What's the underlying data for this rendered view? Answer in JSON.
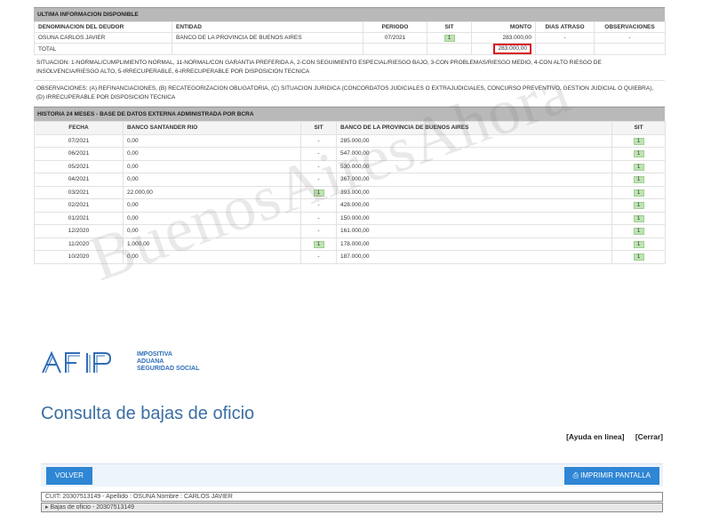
{
  "ultima": {
    "header": "ULTIMA INFORMACION DISPONIBLE",
    "columns": [
      "DENOMINACION DEL DEUDOR",
      "ENTIDAD",
      "PERIODO",
      "SIT",
      "MONTO",
      "DIAS ATRASO",
      "OBSERVACIONES"
    ],
    "row": {
      "deudor": "OSUNA CARLOS JAVIER",
      "entidad": "BANCO DE LA PROVINCIA DE BUENOS AIRES",
      "periodo": "07/2021",
      "sit": "1",
      "monto": "283.000,00",
      "dias": "-",
      "obs": "-"
    },
    "total_label": "TOTAL",
    "total_value": "283.000,00"
  },
  "situacion_note": "SITUACION: 1-NORMAL/CUMPLIMIENTO NORMAL, 11-NORMAL/CON GARANTIA PREFERIDA A, 2-CON SEGUIMIENTO ESPECIAL/RIESGO BAJO, 3-CON PROBLEMAS/RIESGO MEDIO, 4-CON ALTO RIESGO DE INSOLVENCIA/RIESGO ALTO, 5-IRRECUPERABLE, 6-IRRECUPERABLE POR DISPOSICION TECNICA",
  "observaciones_note": "OBSERVACIONES: (A) REFINANCIACIONES, (B) RECATEGORIZACION OBLIGATORIA, (C) SITUACION JURIDICA (CONCORDATOS JUDICIALES O EXTRAJUDICIALES, CONCURSO PREVENTIVO, GESTION JUDICIAL O QUIEBRA), (D) IRRECUPERABLE POR DISPOSICION TECNICA",
  "historia": {
    "header": "HISTORIA 24 MESES - BASE DE DATOS EXTERNA ADMINISTRADA POR BCRA",
    "columns": [
      "FECHA",
      "BANCO SANTANDER RIO",
      "SIT",
      "BANCO DE LA PROVINCIA DE BUENOS AIRES",
      "SIT"
    ],
    "rows": [
      {
        "fecha": "07/2021",
        "santander": "0,00",
        "sit1": "-",
        "provincia": "285.000,00",
        "sit2": "1"
      },
      {
        "fecha": "06/2021",
        "santander": "0,00",
        "sit1": "-",
        "provincia": "547.000,00",
        "sit2": "1"
      },
      {
        "fecha": "05/2021",
        "santander": "0,00",
        "sit1": "-",
        "provincia": "530.000,00",
        "sit2": "1"
      },
      {
        "fecha": "04/2021",
        "santander": "0,00",
        "sit1": "-",
        "provincia": "367.000,00",
        "sit2": "1"
      },
      {
        "fecha": "03/2021",
        "santander": "22.000,00",
        "sit1": "1",
        "provincia": "393.000,00",
        "sit2": "1"
      },
      {
        "fecha": "02/2021",
        "santander": "0,00",
        "sit1": "-",
        "provincia": "428.000,00",
        "sit2": "1"
      },
      {
        "fecha": "01/2021",
        "santander": "0,00",
        "sit1": "-",
        "provincia": "150.000,00",
        "sit2": "1"
      },
      {
        "fecha": "12/2020",
        "santander": "0,00",
        "sit1": "-",
        "provincia": "161.000,00",
        "sit2": "1"
      },
      {
        "fecha": "11/2020",
        "santander": "1.000,00",
        "sit1": "1",
        "provincia": "178.000,00",
        "sit2": "1"
      },
      {
        "fecha": "10/2020",
        "santander": "0,00",
        "sit1": "-",
        "provincia": "187.000,00",
        "sit2": "1"
      }
    ]
  },
  "watermark": "BuenosAiresAhora",
  "afip": {
    "logo_text": "AFIP",
    "logo_lines": [
      "IMPOSITIVA",
      "ADUANA",
      "SEGURIDAD SOCIAL"
    ],
    "page_title": "Consulta de bajas de oficio",
    "link_help": "[Ayuda en linea]",
    "link_close": "[Cerrar]",
    "btn_volver": "VOLVER",
    "btn_print": "IMPRIMIR PANTALLA",
    "print_icon": "printer-icon",
    "info_line1": "CUIT: 20307513149 - Apellido : OSUNA Nombre : CARLOS JAVIER",
    "info_line2": "Bajas de oficio - 20307513149"
  },
  "colors": {
    "accent": "#2f86d4",
    "title": "#3a6ea3",
    "highlight": "#d8141c",
    "sit_green": "#bfe3b4"
  }
}
